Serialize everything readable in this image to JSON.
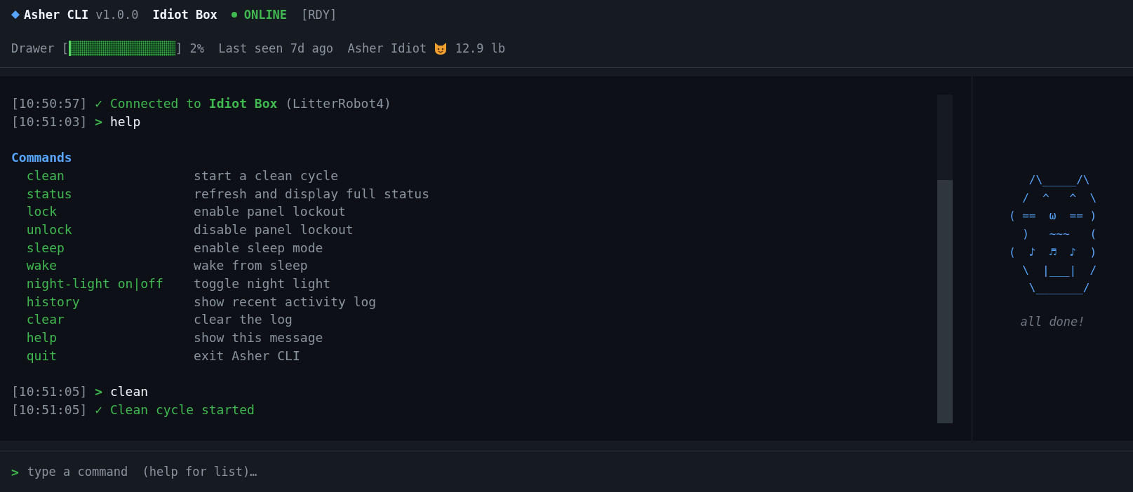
{
  "header": {
    "app_name": "Asher CLI",
    "version": "v1.0.0",
    "device": "Idiot Box",
    "status": {
      "label": "ONLINE",
      "online": true
    },
    "state": "[RDY]"
  },
  "info_bar": {
    "drawer_label": "Drawer",
    "bracket_open": "[",
    "bracket_close": "]",
    "drawer": {
      "level": 0.02
    },
    "percent": "2%",
    "last_seen": "Last seen 7d ago",
    "cat_name": "Asher Idiot",
    "weight": "12.9 lb"
  },
  "log": [
    {
      "kind": "ok",
      "time": "[10:50:57]",
      "mark": "✓",
      "text": "Connected to **Idiot Box**",
      "note": "(LitterRobot4)"
    },
    {
      "kind": "cmd",
      "time": "[10:51:03]",
      "mark": ">",
      "text": "help"
    },
    {
      "kind": "heading",
      "text": "Commands"
    },
    {
      "kind": "commands",
      "items": [
        {
          "name": "clean",
          "desc": "start a clean cycle"
        },
        {
          "name": "status",
          "desc": "refresh and display full status"
        },
        {
          "name": "lock",
          "desc": "enable panel lockout"
        },
        {
          "name": "unlock",
          "desc": "disable panel lockout"
        },
        {
          "name": "sleep",
          "desc": "enable sleep mode"
        },
        {
          "name": "wake",
          "desc": "wake from sleep"
        },
        {
          "name": "night-light on|off",
          "desc": "toggle night light"
        },
        {
          "name": "history",
          "desc": "show recent activity log"
        },
        {
          "name": "clear",
          "desc": "clear the log"
        },
        {
          "name": "help",
          "desc": "show this message"
        },
        {
          "name": "quit",
          "desc": "exit Asher CLI"
        }
      ]
    },
    {
      "kind": "cmd",
      "time": "[10:51:05]",
      "mark": ">",
      "text": "clean"
    },
    {
      "kind": "ok",
      "time": "[10:51:05]",
      "mark": "✓",
      "text": "Clean cycle started"
    }
  ],
  "sidebar": {
    "art_lines": [
      "   /\\_____/\\",
      "  /  ^   ^  \\",
      "( ==  ω  == )",
      "  )   ~~~   (",
      "(  ♪  ♬  ♪  )",
      "  \\  |___|  /",
      "   \\_______/"
    ],
    "caption": "all done!"
  },
  "input": {
    "prompt": ">",
    "placeholder": "type a command  (help for list)…"
  }
}
